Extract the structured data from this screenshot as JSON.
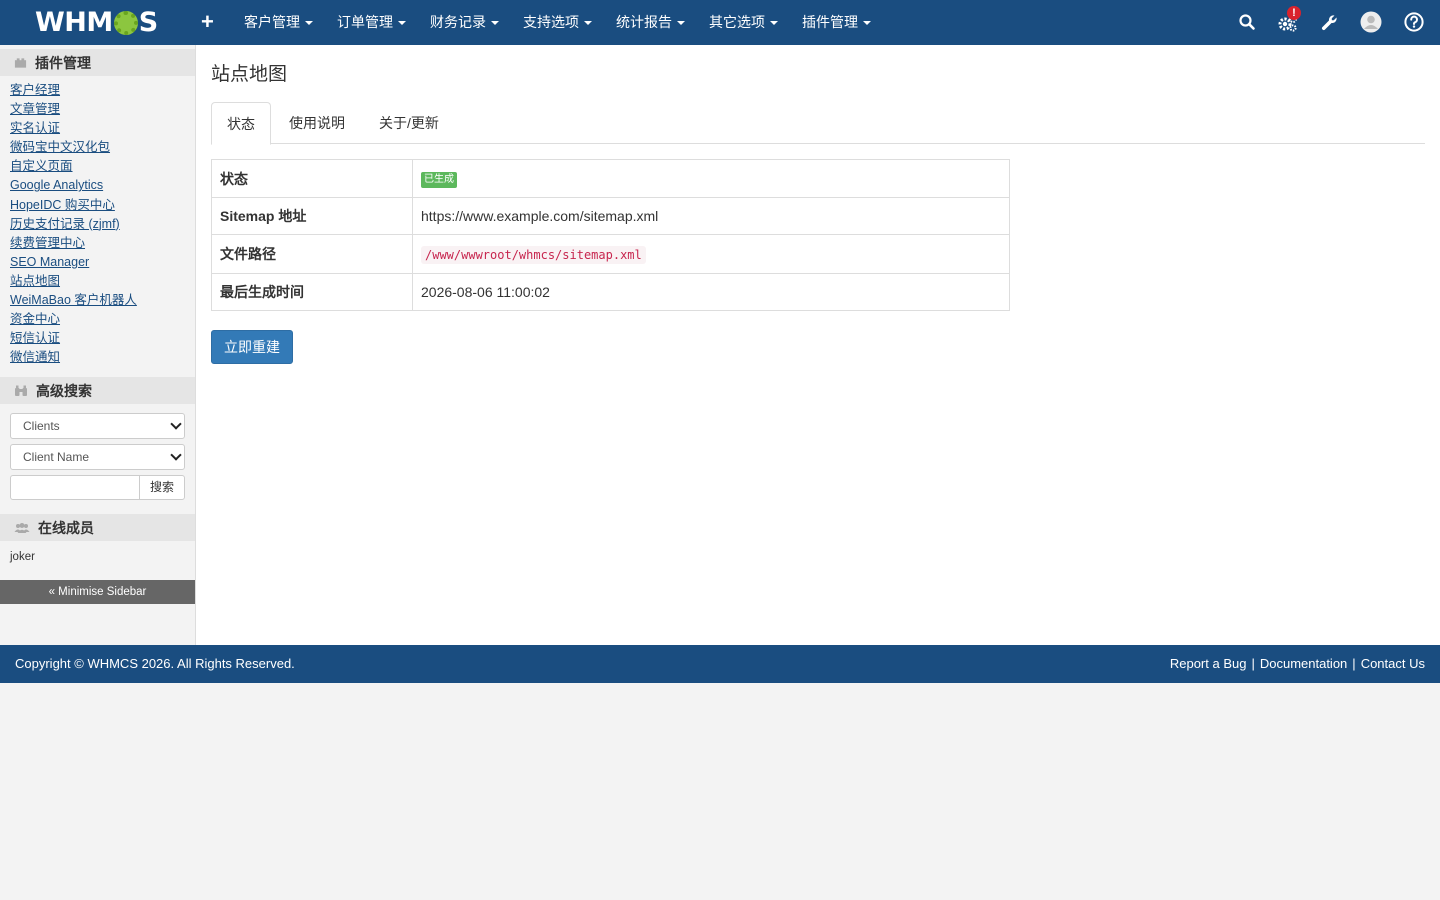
{
  "nav": {
    "logo": "WHMCS",
    "logo_left": "WHM",
    "logo_right": "S",
    "plus": "+",
    "menu": [
      "客户管理",
      "订单管理",
      "财务记录",
      "支持选项",
      "统计报告",
      "其它选项",
      "插件管理"
    ],
    "alert_badge": "!"
  },
  "sidebar": {
    "addons_title": "插件管理",
    "addons": [
      "客户经理",
      "文章管理",
      "实名认证",
      "微码宝中文汉化包",
      "自定义页面",
      "Google Analytics",
      "HopeIDC 购买中心",
      "历史支付记录 (zjmf)",
      "续费管理中心",
      "SEO Manager",
      "站点地图",
      "WeiMaBao 客户机器人",
      "资金中心",
      "短信认证",
      "微信通知"
    ],
    "search_title": "高级搜索",
    "search_type": "Clients",
    "search_field": "Client Name",
    "search_value": "",
    "search_button": "搜索",
    "online_title": "在线成员",
    "online_user": "joker",
    "minimise": "« Minimise Sidebar"
  },
  "main": {
    "title": "站点地图",
    "tabs": [
      "状态",
      "使用说明",
      "关于/更新"
    ],
    "rows": [
      {
        "label": "状态",
        "value": "已生成"
      },
      {
        "label": "Sitemap 地址",
        "value": "https://www.example.com/sitemap.xml"
      },
      {
        "label": "文件路径",
        "value": "/www/wwwroot/whmcs/sitemap.xml"
      },
      {
        "label": "最后生成时间",
        "value": "2026-08-06 11:00:02"
      }
    ],
    "rebuild_button": "立即重建"
  },
  "footer": {
    "copyright": "Copyright © WHMCS 2026. All Rights Reserved.",
    "links": [
      "Report a Bug",
      "Documentation",
      "Contact Us"
    ],
    "separator": "|"
  },
  "colors": {
    "nav_bg": "#1a4d80",
    "primary_button": "#337ab7",
    "success_badge": "#5cb85c",
    "code_text": "#c7254e"
  },
  "icons": {
    "search": "search-icon",
    "settings": "cogs-icon",
    "tools": "wrench-icon",
    "user": "user-avatar-icon",
    "help": "help-icon"
  }
}
